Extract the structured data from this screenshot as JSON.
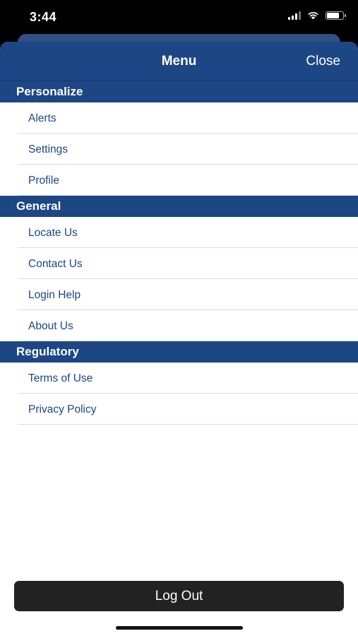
{
  "status_bar": {
    "time": "3:44",
    "icons": [
      "cellular-signal-icon",
      "wifi-icon",
      "battery-icon"
    ],
    "battery_level": 0.8
  },
  "nav": {
    "title": "Menu",
    "close_label": "Close"
  },
  "sections": [
    {
      "title": "Personalize",
      "items": [
        "Alerts",
        "Settings",
        "Profile"
      ]
    },
    {
      "title": "General",
      "items": [
        "Locate Us",
        "Contact Us",
        "Login Help",
        "About Us"
      ]
    },
    {
      "title": "Regulatory",
      "items": [
        "Terms of Use",
        "Privacy Policy"
      ]
    }
  ],
  "logout_label": "Log Out",
  "colors": {
    "brand": "#1d4685",
    "link": "#1d4685",
    "button": "#222222"
  }
}
